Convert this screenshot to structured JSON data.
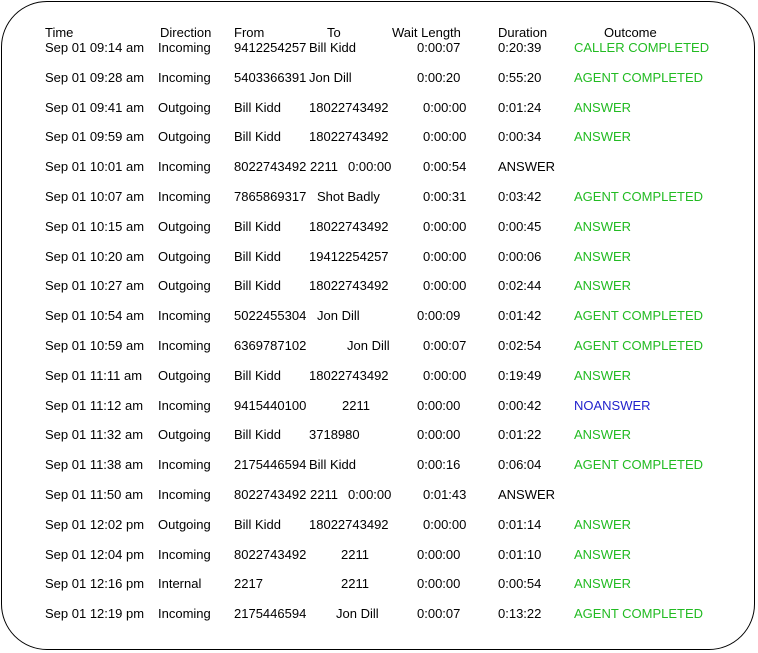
{
  "headers": {
    "time": "Time",
    "direction": "Direction",
    "from": "From",
    "to": "To",
    "wait": "Wait Length",
    "duration": "Duration",
    "outcome": "Outcome"
  },
  "colors": {
    "green": "#22bb22",
    "blue": "#1f1fcc",
    "black": "#000000"
  },
  "rows": [
    {
      "time": "Sep 01 09:14 am",
      "direction": "Incoming",
      "from": "9412254257",
      "to": "Bill Kidd",
      "wait": "0:00:07",
      "duration": "0:20:39",
      "outcome": "CALLER COMPLETED",
      "outcome_color": "green"
    },
    {
      "time": "Sep 01 09:28 am",
      "direction": "Incoming",
      "from": "5403366391",
      "to": "Jon Dill",
      "wait": "0:00:20",
      "duration": "0:55:20",
      "outcome": "AGENT COMPLETED",
      "outcome_color": "green"
    },
    {
      "time": "Sep 01 09:41 am",
      "direction": "Outgoing",
      "from": "Bill Kidd",
      "to": "18022743492",
      "wait": "0:00:00",
      "duration": "0:01:24",
      "outcome": "ANSWER",
      "outcome_color": "green"
    },
    {
      "time": "Sep 01 09:59 am",
      "direction": "Outgoing",
      "from": "Bill Kidd",
      "to": "18022743492",
      "wait": "0:00:00",
      "duration": "0:00:34",
      "outcome": "ANSWER",
      "outcome_color": "green"
    },
    {
      "time": "Sep 01 10:01 am",
      "direction": "Incoming",
      "from": "8022743492",
      "to": "2211",
      "wait": "0:00:00",
      "duration": "0:00:54",
      "outcome": "ANSWER",
      "outcome_color": "black",
      "shifted": true
    },
    {
      "time": "Sep 01 10:07 am",
      "direction": "Incoming",
      "from": "7865869317",
      "to": "Shot Badly",
      "wait": "0:00:31",
      "duration": "0:03:42",
      "outcome": "AGENT COMPLETED",
      "outcome_color": "green"
    },
    {
      "time": "Sep 01 10:15 am",
      "direction": "Outgoing",
      "from": "Bill Kidd",
      "to": "18022743492",
      "wait": "0:00:00",
      "duration": "0:00:45",
      "outcome": "ANSWER",
      "outcome_color": "green"
    },
    {
      "time": "Sep 01 10:20 am",
      "direction": "Outgoing",
      "from": "Bill Kidd",
      "to": "19412254257",
      "wait": "0:00:00",
      "duration": "0:00:06",
      "outcome": "ANSWER",
      "outcome_color": "green"
    },
    {
      "time": "Sep 01 10:27 am",
      "direction": "Outgoing",
      "from": "Bill Kidd",
      "to": "18022743492",
      "wait": "0:00:00",
      "duration": "0:02:44",
      "outcome": "ANSWER",
      "outcome_color": "green"
    },
    {
      "time": "Sep 01 10:54 am",
      "direction": "Incoming",
      "from": "5022455304",
      "to": "Jon Dill",
      "wait": "0:00:09",
      "duration": "0:01:42",
      "outcome": "AGENT COMPLETED",
      "outcome_color": "green"
    },
    {
      "time": "Sep 01 10:59 am",
      "direction": "Incoming",
      "from": "6369787102",
      "to": "Jon Dill",
      "wait": "0:00:07",
      "duration": "0:02:54",
      "outcome": "AGENT COMPLETED",
      "outcome_color": "green"
    },
    {
      "time": "Sep 01 11:11 am",
      "direction": "Outgoing",
      "from": "Bill Kidd",
      "to": "18022743492",
      "wait": "0:00:00",
      "duration": "0:19:49",
      "outcome": "ANSWER",
      "outcome_color": "green"
    },
    {
      "time": "Sep 01 11:12 am",
      "direction": "Incoming",
      "from": "9415440100",
      "to": "2211",
      "wait": "0:00:00",
      "duration": "0:00:42",
      "outcome": "NOANSWER",
      "outcome_color": "blue"
    },
    {
      "time": "Sep 01 11:32 am",
      "direction": "Outgoing",
      "from": "Bill Kidd",
      "to": "3718980",
      "wait": "0:00:00",
      "duration": "0:01:22",
      "outcome": "ANSWER",
      "outcome_color": "green"
    },
    {
      "time": "Sep 01 11:38 am",
      "direction": "Incoming",
      "from": "2175446594",
      "to": "Bill Kidd",
      "wait": "0:00:16",
      "duration": "0:06:04",
      "outcome": "AGENT COMPLETED",
      "outcome_color": "green"
    },
    {
      "time": "Sep 01 11:50 am",
      "direction": "Incoming",
      "from": "8022743492",
      "to": "2211",
      "wait": "0:00:00",
      "duration": "0:01:43",
      "outcome": "ANSWER",
      "outcome_color": "black",
      "shifted": true
    },
    {
      "time": "Sep 01 12:02 pm",
      "direction": "Outgoing",
      "from": "Bill Kidd",
      "to": "18022743492",
      "wait": "0:00:00",
      "duration": "0:01:14",
      "outcome": "ANSWER",
      "outcome_color": "green"
    },
    {
      "time": "Sep 01 12:04 pm",
      "direction": "Incoming",
      "from": "8022743492",
      "to": "2211",
      "wait": "0:00:00",
      "duration": "0:01:10",
      "outcome": "ANSWER",
      "outcome_color": "green"
    },
    {
      "time": "Sep 01 12:16 pm",
      "direction": "Internal",
      "from": "2217",
      "to": "2211",
      "wait": "0:00:00",
      "duration": "0:00:54",
      "outcome": "ANSWER",
      "outcome_color": "green"
    },
    {
      "time": "Sep 01 12:19 pm",
      "direction": "Incoming",
      "from": "2175446594",
      "to": "Jon Dill",
      "wait": "0:00:07",
      "duration": "0:13:22",
      "outcome": "AGENT COMPLETED",
      "outcome_color": "green"
    }
  ]
}
